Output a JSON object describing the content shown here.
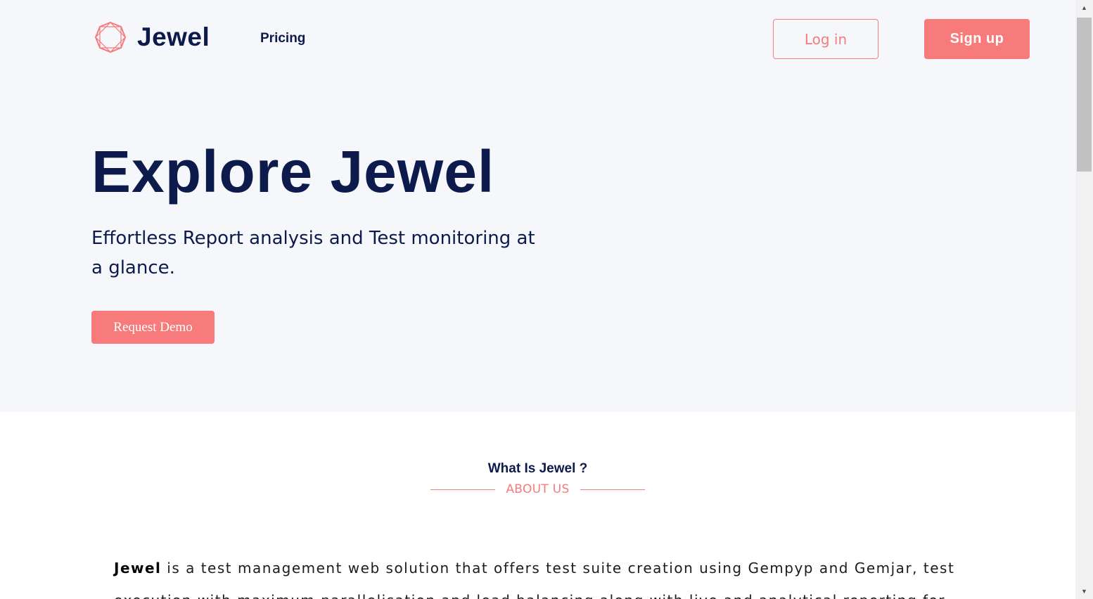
{
  "header": {
    "logo_text": "Jewel",
    "logo_icon": "jewel-gem-icon",
    "nav_pricing": "Pricing",
    "login_label": "Log in",
    "signup_label": "Sign up"
  },
  "hero": {
    "title": "Explore Jewel",
    "subtitle": "Effortless Report analysis and Test monitoring at a glance.",
    "demo_button": "Request Demo"
  },
  "about": {
    "title": "What Is Jewel ?",
    "subtitle": "ABOUT US",
    "text_bold": "Jewel",
    "text_body": " is a test management web solution that offers test suite creation using Gempyp and Gemjar, test execution with maximum parallelisation and load balancing along with live and analytical reporting for"
  },
  "scrollbar": {
    "up_icon": "triangle-up-icon",
    "down_icon": "triangle-down-icon"
  },
  "colors": {
    "accent": "#f77b7b",
    "navy": "#0d1b4c",
    "hero_bg": "#f6f7fb"
  }
}
